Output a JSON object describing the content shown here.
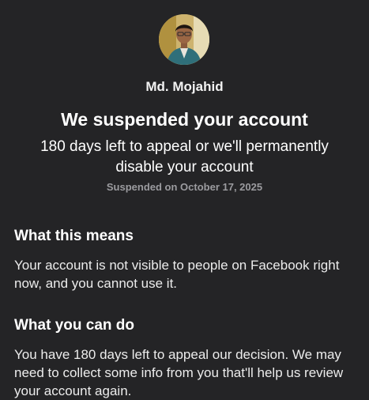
{
  "profile": {
    "name": "Md. Mojahid"
  },
  "notice": {
    "title": "We suspended your account",
    "subtitle": "180 days left to appeal or we'll permanently disable your account",
    "suspended_date": "Suspended on October 17, 2025"
  },
  "sections": [
    {
      "heading": "What this means",
      "body": "Your account is not visible to people on Facebook right now, and you cannot use it."
    },
    {
      "heading": "What you can do",
      "body": "You have 180 days left to appeal our decision. We may need to collect some info from you that'll help us review your account again."
    }
  ],
  "colors": {
    "background": "#242426",
    "primary_text": "#ffffff",
    "secondary_text": "#9b9b9f"
  }
}
